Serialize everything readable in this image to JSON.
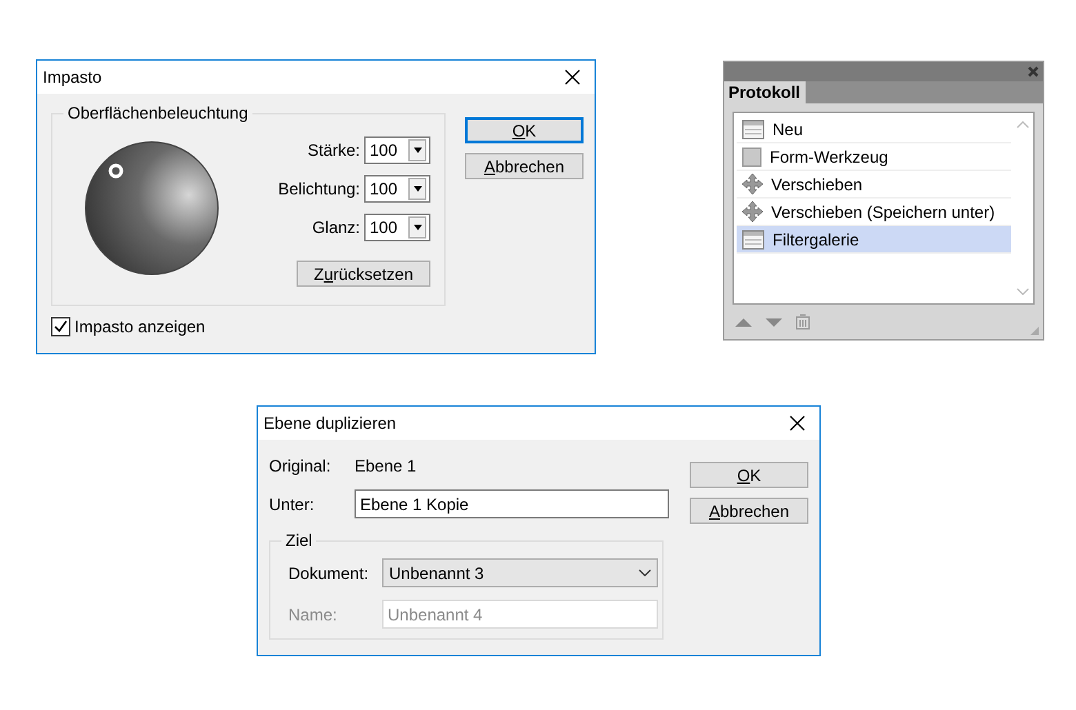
{
  "impasto": {
    "title": "Impasto",
    "group": "Oberflächenbeleuchtung",
    "fields": [
      {
        "label": "Stärke:",
        "value": "100"
      },
      {
        "label": "Belichtung:",
        "value": "100"
      },
      {
        "label": "Glanz:",
        "value": "100"
      }
    ],
    "reset": {
      "before": "Z",
      "key": "u",
      "after": "rücksetzen"
    },
    "checkbox": {
      "label": "Impasto anzeigen",
      "checked": true
    },
    "buttons": [
      {
        "key": "O",
        "after": "K",
        "default": true
      },
      {
        "key": "A",
        "after": "bbrechen",
        "default": false
      }
    ]
  },
  "history": {
    "tab": "Protokoll",
    "items": [
      {
        "label": "Neu",
        "kind": "document",
        "selected": false
      },
      {
        "label": "Form-Werkzeug",
        "kind": "shape",
        "selected": false
      },
      {
        "label": "Verschieben",
        "kind": "move",
        "selected": false
      },
      {
        "label": "Verschieben (Speichern unter)",
        "kind": "move",
        "selected": false
      },
      {
        "label": "Filtergalerie",
        "kind": "document",
        "selected": true
      }
    ]
  },
  "duplicate": {
    "title": "Ebene duplizieren",
    "original_label": "Original:",
    "original_value": "Ebene 1",
    "as_label": "Unter:",
    "as_value": "Ebene 1 Kopie",
    "group": "Ziel",
    "rows": [
      {
        "label": "Dokument:",
        "value": "Unbenannt 3",
        "kind": "dropdown",
        "disabled": false
      },
      {
        "label": "Name:",
        "value": "Unbenannt 4",
        "kind": "text",
        "disabled": true
      }
    ],
    "buttons": [
      {
        "key": "O",
        "after": "K",
        "default": false
      },
      {
        "key": "A",
        "after": "bbrechen",
        "default": false
      }
    ]
  }
}
